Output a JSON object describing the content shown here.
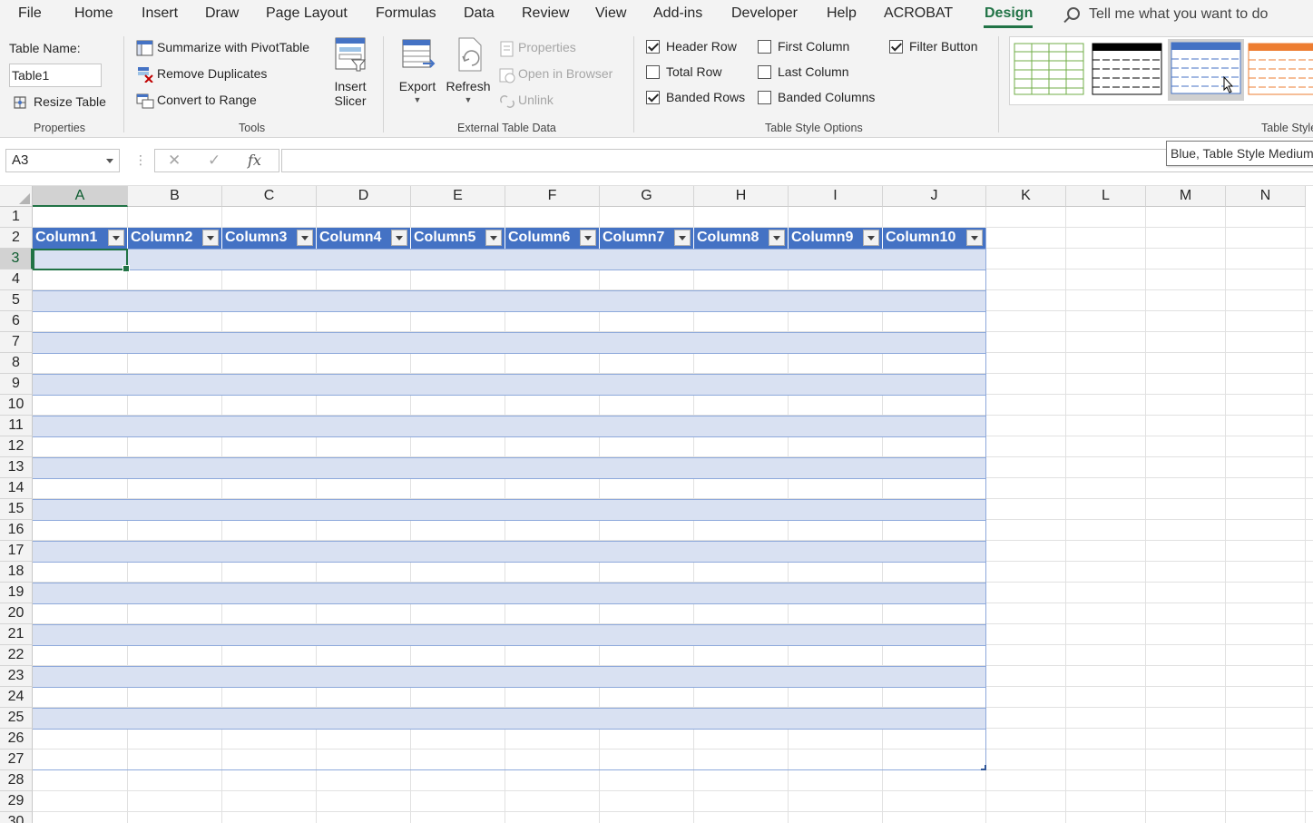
{
  "menu": {
    "items": [
      "File",
      "Home",
      "Insert",
      "Draw",
      "Page Layout",
      "Formulas",
      "Data",
      "Review",
      "View",
      "Add-ins",
      "Developer",
      "Help",
      "ACROBAT",
      "Design"
    ],
    "active": "Design",
    "tell_me": "Tell me what you want to do"
  },
  "ribbon": {
    "properties": {
      "table_name_label": "Table Name:",
      "table_name_value": "Table1",
      "resize_table": "Resize Table",
      "group_label": "Properties"
    },
    "tools": {
      "summarize": "Summarize with PivotTable",
      "remove_duplicates": "Remove Duplicates",
      "convert_to_range": "Convert to Range",
      "insert_slicer_1": "Insert",
      "insert_slicer_2": "Slicer",
      "group_label": "Tools"
    },
    "external": {
      "export": "Export",
      "refresh": "Refresh",
      "properties": "Properties",
      "open_in_browser": "Open in Browser",
      "unlink": "Unlink",
      "group_label": "External Table Data"
    },
    "style_options": {
      "header_row": {
        "label": "Header Row",
        "checked": true
      },
      "total_row": {
        "label": "Total Row",
        "checked": false
      },
      "banded_rows": {
        "label": "Banded Rows",
        "checked": true
      },
      "first_column": {
        "label": "First Column",
        "checked": false
      },
      "last_column": {
        "label": "Last Column",
        "checked": false
      },
      "banded_columns": {
        "label": "Banded Columns",
        "checked": false
      },
      "filter_button": {
        "label": "Filter Button",
        "checked": true
      },
      "group_label": "Table Style Options"
    },
    "table_styles": {
      "group_label": "Table Style",
      "swatches": [
        {
          "color": "#70ad47"
        },
        {
          "color": "#000000"
        },
        {
          "color": "#4472c4"
        },
        {
          "color": "#ed7d31"
        }
      ]
    }
  },
  "formula_bar": {
    "cell_ref": "A3",
    "cancel_icon": "✕",
    "enter_icon": "✓",
    "fx": "fx",
    "value": ""
  },
  "tooltip": "Blue, Table Style Medium",
  "sheet": {
    "columns": [
      "A",
      "B",
      "C",
      "D",
      "E",
      "F",
      "G",
      "H",
      "I",
      "J",
      "K",
      "L",
      "M",
      "N"
    ],
    "selected_column": "A",
    "selected_row": "3",
    "rows": [
      "1",
      "2",
      "3",
      "4",
      "5",
      "6",
      "7",
      "8",
      "9",
      "10",
      "11",
      "12",
      "13",
      "14",
      "15",
      "16",
      "17",
      "18",
      "19",
      "20",
      "21",
      "22",
      "23",
      "24",
      "25",
      "26",
      "27",
      "28",
      "29",
      "30"
    ],
    "table_headers": [
      "Column1",
      "Column2",
      "Column3",
      "Column4",
      "Column5",
      "Column6",
      "Column7",
      "Column8",
      "Column9",
      "Column10"
    ],
    "colors": {
      "header_bg": "#4472c4",
      "band_bg": "#d9e1f2",
      "band_border": "#8ea9db",
      "accent": "#217346"
    }
  }
}
